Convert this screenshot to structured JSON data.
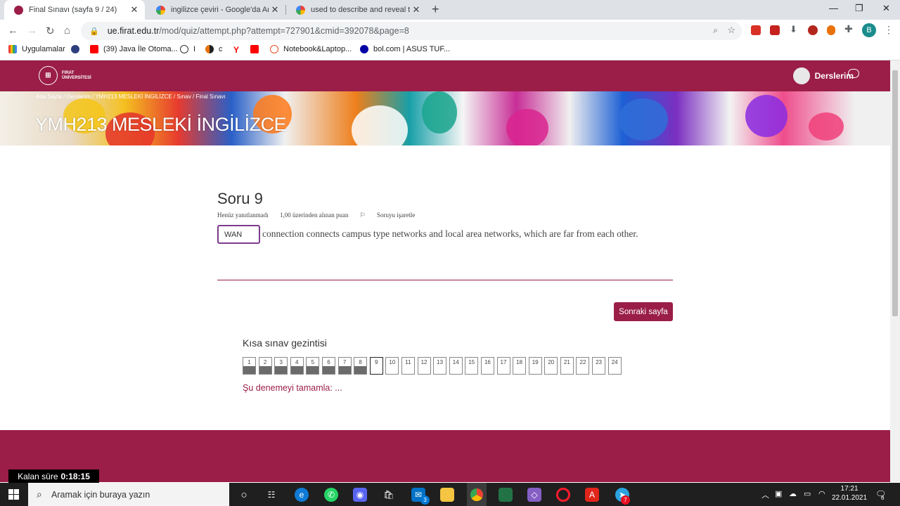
{
  "browser": {
    "tabs": [
      {
        "title": "Final Sınavı (sayfa 9 / 24)",
        "active": true
      },
      {
        "title": "ingilizce çeviri - Google'da Ara",
        "active": false
      },
      {
        "title": "used to describe and reveal the t",
        "active": false
      }
    ],
    "url_host": "ue.firat.edu.tr",
    "url_path": "/mod/quiz/attempt.php?attempt=727901&cmid=392078&page=8",
    "profile_initial": "B",
    "bookmarks": [
      "Uygulamalar",
      "(39) Java İle Otoma...",
      "I",
      "c",
      "Notebook&Laptop...",
      "bol.com | ASUS TUF..."
    ]
  },
  "site": {
    "logo_line1": "FIRAT",
    "logo_line2": "ÜNİVERSİTESİ",
    "user_menu": "Derslerim",
    "breadcrumbs": "Ana Sayfa  /  Derslerim  /  YMH213 MESLEKİ İNGİLİZCE  /  Sınav  /  Final Sınavı",
    "course_title": "YMH213 MESLEKİ İNGİLİZCE"
  },
  "question": {
    "title": "Soru 9",
    "status": "Henüz yanıtlanmadı",
    "points": "1,00 üzerinden alınan puan",
    "flag": "Soruyu işaretle",
    "answer": "WAN",
    "text": "connection connects campus type networks and local area networks, which are far from each other.",
    "next_button": "Sonraki sayfa"
  },
  "quiz_nav": {
    "title": "Kısa sınav gezintisi",
    "questions": [
      "1",
      "2",
      "3",
      "4",
      "5",
      "6",
      "7",
      "8",
      "9",
      "10",
      "11",
      "12",
      "13",
      "14",
      "15",
      "16",
      "17",
      "18",
      "19",
      "20",
      "21",
      "22",
      "23",
      "24"
    ],
    "answered_count": 8,
    "current": "9",
    "finish_link": "Şu denemeyi tamamla: ..."
  },
  "timer": {
    "label": "Kalan süre",
    "value": "0:18:15"
  },
  "taskbar": {
    "search_placeholder": "Aramak için buraya yazın",
    "mail_badge": "3",
    "telegram_badge": "7",
    "time": "17:21",
    "date": "22.01.2021",
    "notifications": "6"
  },
  "colors": {
    "brand": "#9a1e47",
    "focus": "#7d3b8c"
  }
}
